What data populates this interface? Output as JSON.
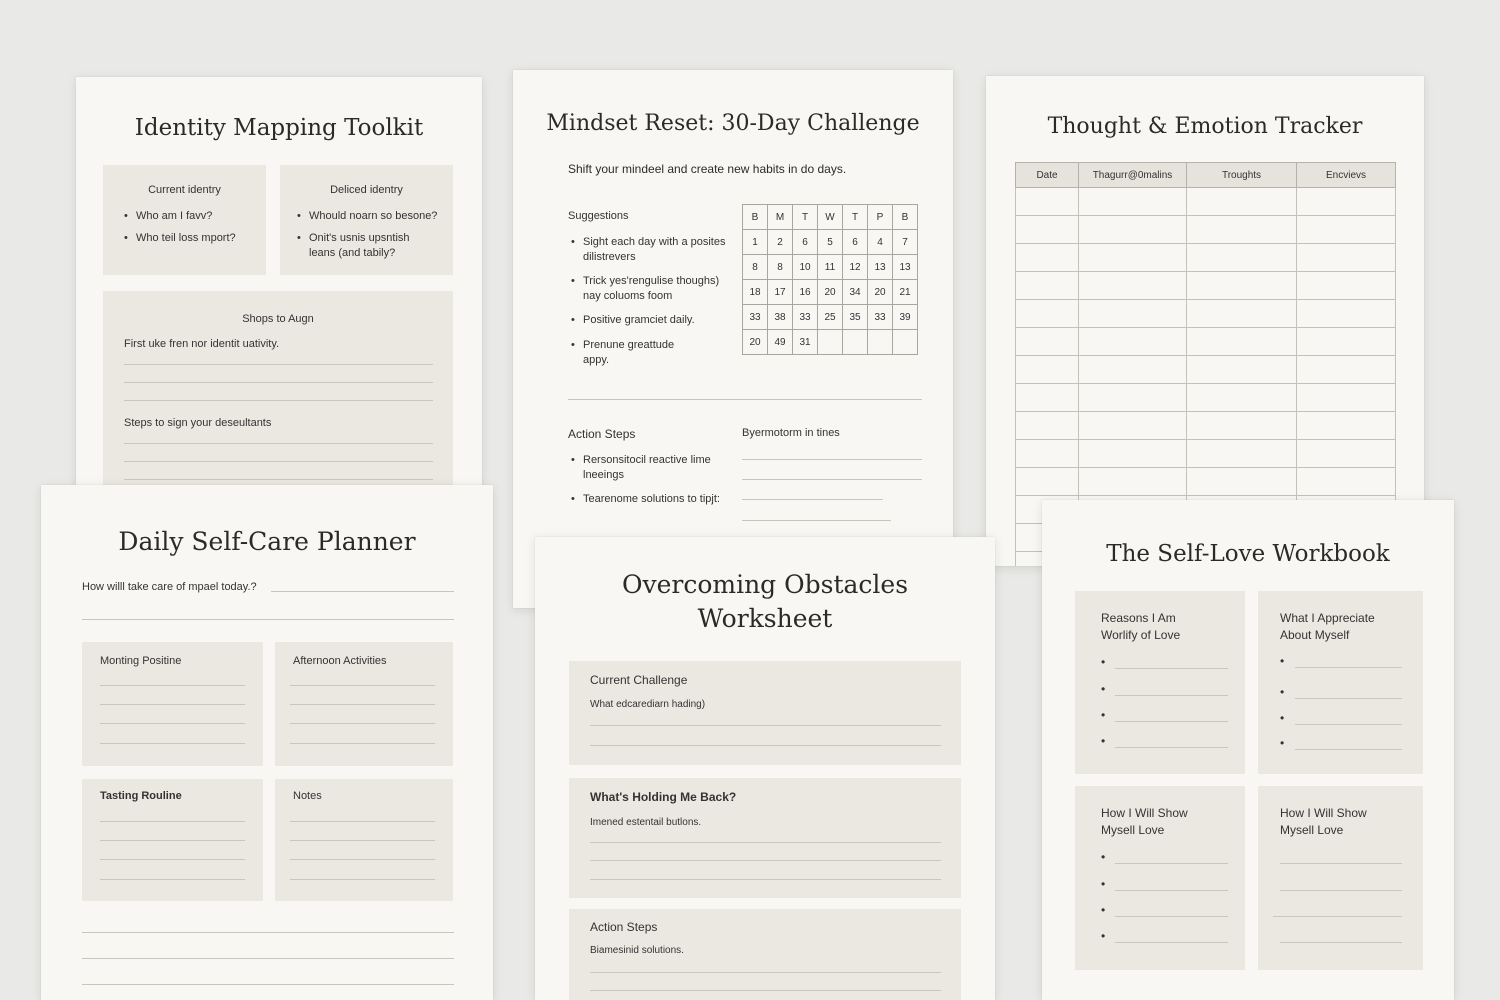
{
  "identity": {
    "title": "Identity Mapping Toolkit",
    "current": {
      "heading": "Current identry",
      "items": [
        "Who am I favv?",
        "Who teil loss mport?"
      ]
    },
    "desired": {
      "heading": "Deliced identry",
      "items": [
        "Whould noarn so besone?",
        "Onit's usnis upsntish leans (and tabily?"
      ]
    },
    "steps": {
      "heading": "Shops to Augn",
      "prompt1": "First uke fren nor identit uativity.",
      "prompt2": "Steps to sign your deseultants"
    }
  },
  "mindset": {
    "title": "Mindset Reset: 30-Day Challenge",
    "subtitle": "Shift your mindeel and create new habits in do days.",
    "suggestions": {
      "heading": "Suggestions",
      "items": [
        "Sight each day with a posites dilistrevers",
        "Trick yes'rengulise thoughs) nay coluoms foom",
        "Positive gramciet daily.",
        "Prenune greattude appy."
      ]
    },
    "calendar": {
      "header": [
        "B",
        "M",
        "T",
        "W",
        "T",
        "P",
        "B"
      ],
      "rows": [
        [
          "1",
          "2",
          "6",
          "5",
          "6",
          "4",
          "7"
        ],
        [
          "8",
          "8",
          "10",
          "11",
          "12",
          "13",
          "13"
        ],
        [
          "18",
          "17",
          "16",
          "20",
          "34",
          "20",
          "21"
        ],
        [
          "33",
          "38",
          "33",
          "25",
          "35",
          "33",
          "39"
        ],
        [
          "20",
          "49",
          "31",
          "",
          "",
          "",
          ""
        ]
      ]
    },
    "action": {
      "heading": "Action Steps",
      "items": [
        "Rersonsitocil reactive lime lneeings",
        "Tearenome solutions to tipjt:"
      ],
      "right_label": "Byermotorm in tines"
    }
  },
  "tracker": {
    "title": "Thought & Emotion Tracker",
    "columns": [
      "Date",
      "Thagurr@0malins",
      "Troughts",
      "Encvievs"
    ]
  },
  "selfcare": {
    "title": "Daily Self-Care Planner",
    "prompt": "How willl take care of mpael today.?",
    "boxes": [
      "Monting Positine",
      "Afternoon Activities",
      "Tasting Rouline",
      "Notes"
    ]
  },
  "obstacles": {
    "title_line1": "Overcoming Obstacles",
    "title_line2": "Worksheet",
    "sections": [
      {
        "heading": "Current Challenge",
        "prompt": "What edcarediarn hading)"
      },
      {
        "heading": "What's Holding Me Back?",
        "prompt": "Imened estentail butlons."
      },
      {
        "heading": "Action Steps",
        "prompt": "Biamesinid solutions."
      }
    ]
  },
  "selflove": {
    "title": "The Self-Love Workbook",
    "boxes": [
      {
        "line1": "Reasons I Am",
        "line2": "Worlify of Love"
      },
      {
        "line1": "What I Appreciate",
        "line2": "About Myself"
      },
      {
        "line1": "How I Will Show",
        "line2": "Mysell Love"
      },
      {
        "line1": "How I Will Show",
        "line2": "Mysell Love"
      }
    ]
  }
}
